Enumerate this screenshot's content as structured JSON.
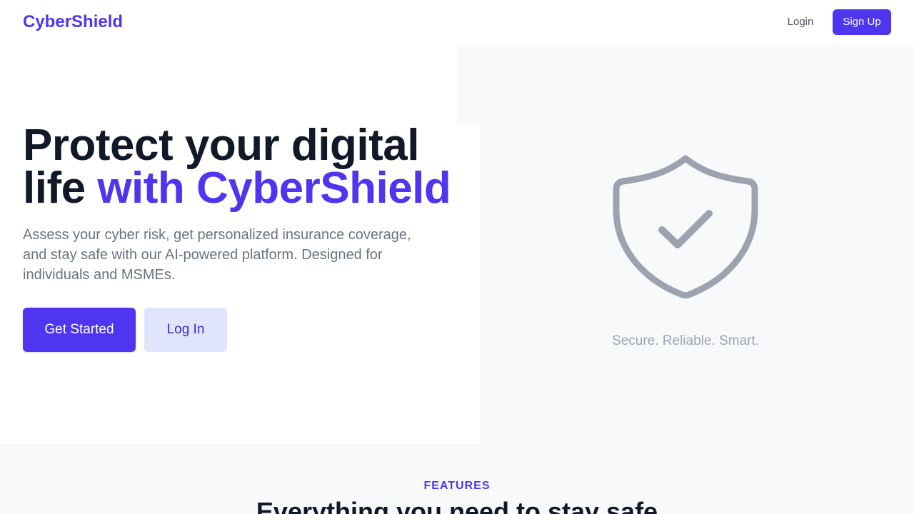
{
  "nav": {
    "brand": "CyberShield",
    "login_label": "Login",
    "signup_label": "Sign Up"
  },
  "hero": {
    "title_part1": "Protect your digital life ",
    "title_accent": "with CyberShield",
    "subtitle": "Assess your cyber risk, get personalized insurance coverage, and stay safe with our AI-powered platform. Designed for individuals and MSMEs.",
    "primary_button": "Get Started",
    "secondary_button": "Log In",
    "illustration_icon": "shield-check-icon",
    "tagline": "Secure. Reliable. Smart."
  },
  "features": {
    "eyebrow": "FEATURES",
    "heading": "Everything you need to stay safe"
  },
  "colors": {
    "brand": "#4f35f0",
    "text_dark": "#111827",
    "text_muted": "#6b7280",
    "panel_bg": "#f8f9fb",
    "icon_gray": "#9ca3af"
  }
}
